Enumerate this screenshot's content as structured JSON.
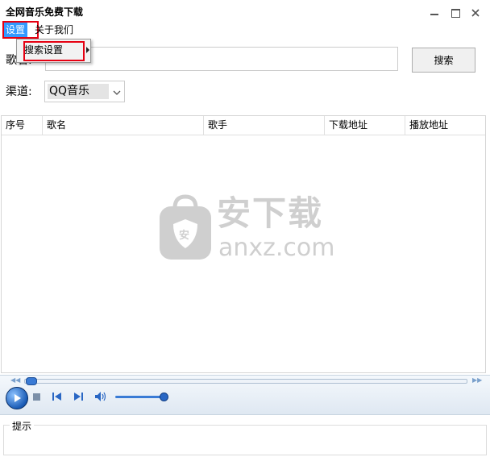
{
  "window": {
    "title": "全网音乐免费下载"
  },
  "menu": {
    "settings_label": "设置",
    "about_label": "关于我们"
  },
  "dropdown": {
    "search_settings_label": "搜索设置"
  },
  "search": {
    "label": "歌名:",
    "value": "",
    "button_label": "搜索"
  },
  "channel": {
    "label": "渠道:",
    "selected": "QQ音乐"
  },
  "table": {
    "columns": [
      "序号",
      "歌名",
      "歌手",
      "下载地址",
      "播放地址"
    ],
    "rows": []
  },
  "hint": {
    "label": "提示"
  },
  "watermark": {
    "text": "安下载",
    "domain": "anxz.com",
    "badge": "安"
  },
  "colors": {
    "highlight": "#e60012",
    "menu_active": "#3399ff",
    "player_blue": "#1a5bb5"
  }
}
